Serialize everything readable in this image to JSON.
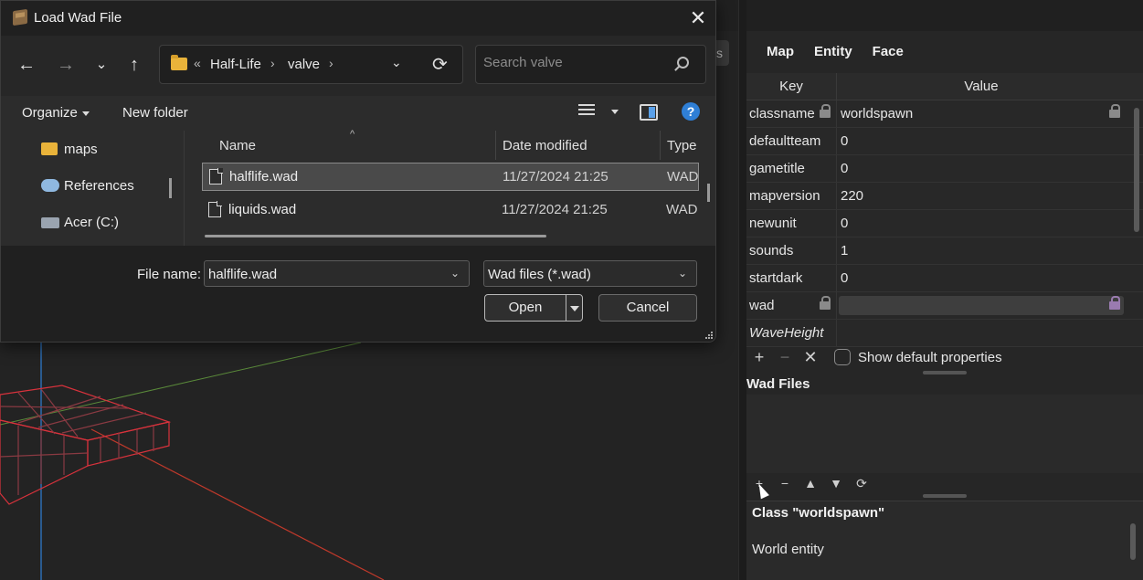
{
  "dialog": {
    "title": "Load Wad File",
    "close_label": "✕",
    "breadcrumb": [
      "Half-Life",
      "valve"
    ],
    "breadcrumb_prefix": "«",
    "search_placeholder": "Search valve",
    "organize_label": "Organize",
    "new_folder_label": "New folder",
    "help_label": "?",
    "nav_items": [
      {
        "label": "maps",
        "icon": "folder-icon"
      },
      {
        "label": "References",
        "icon": "cloud-folder-icon"
      },
      {
        "label": "Acer (C:)",
        "icon": "drive-icon"
      }
    ],
    "columns": {
      "name": "Name",
      "date": "Date modified",
      "type": "Type"
    },
    "files": [
      {
        "name": "halflife.wad",
        "date": "11/27/2024 21:25",
        "type": "WAD",
        "selected": true
      },
      {
        "name": "liquids.wad",
        "date": "11/27/2024 21:25",
        "type": "WAD",
        "selected": false
      }
    ],
    "file_name_label": "File name:",
    "file_name_value": "halflife.wad",
    "file_type_value": "Wad files (*.wad)",
    "open_label": "Open",
    "cancel_label": "Cancel"
  },
  "panel": {
    "tabs": [
      "Map",
      "Entity",
      "Face"
    ],
    "headers": {
      "key": "Key",
      "value": "Value"
    },
    "properties": [
      {
        "key": "classname",
        "value": "worldspawn",
        "locked": true
      },
      {
        "key": "defaultteam",
        "value": "0"
      },
      {
        "key": "gametitle",
        "value": "0"
      },
      {
        "key": "mapversion",
        "value": "220"
      },
      {
        "key": "newunit",
        "value": "0"
      },
      {
        "key": "sounds",
        "value": "1"
      },
      {
        "key": "startdark",
        "value": "0"
      },
      {
        "key": "wad",
        "value": "",
        "locked": true
      },
      {
        "key": "WaveHeight",
        "value": "",
        "italic": true
      }
    ],
    "show_default_label": "Show default properties",
    "wad_files_title": "Wad Files",
    "class_title": "Class \"worldspawn\"",
    "class_desc": "World entity"
  },
  "side_stub": "s",
  "colors": {
    "accent_blue": "#2f7fd6",
    "folder": "#e9b33a",
    "brush_red": "#d8323c",
    "lock_purple": "#9a7bb0"
  }
}
